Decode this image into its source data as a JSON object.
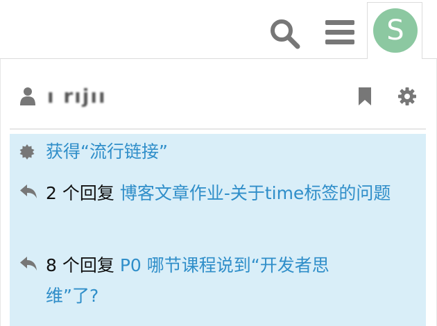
{
  "header": {
    "avatar_letter": "S",
    "avatar_color": "#8cc8a1",
    "icons": [
      "search-icon",
      "hamburger-menu-icon"
    ]
  },
  "panel": {
    "username": "ı rıjıı",
    "icons": [
      "user-icon",
      "bookmark-icon",
      "gear-icon"
    ]
  },
  "notifications": [
    {
      "icon": "badge-icon",
      "prefix": "",
      "link": "获得“流行链接”"
    },
    {
      "icon": "reply-icon",
      "prefix": "2 个回复 ",
      "link": "博客文章作业-关于time标签的问题"
    },
    {
      "icon": "reply-icon",
      "prefix": "8 个回复 ",
      "link": "P0 哪节课程说到“开发者思维”了?"
    }
  ],
  "colors": {
    "accent": "#2f8ec9",
    "notification_bg": "#d9eef8",
    "icon_gray": "#777777"
  }
}
